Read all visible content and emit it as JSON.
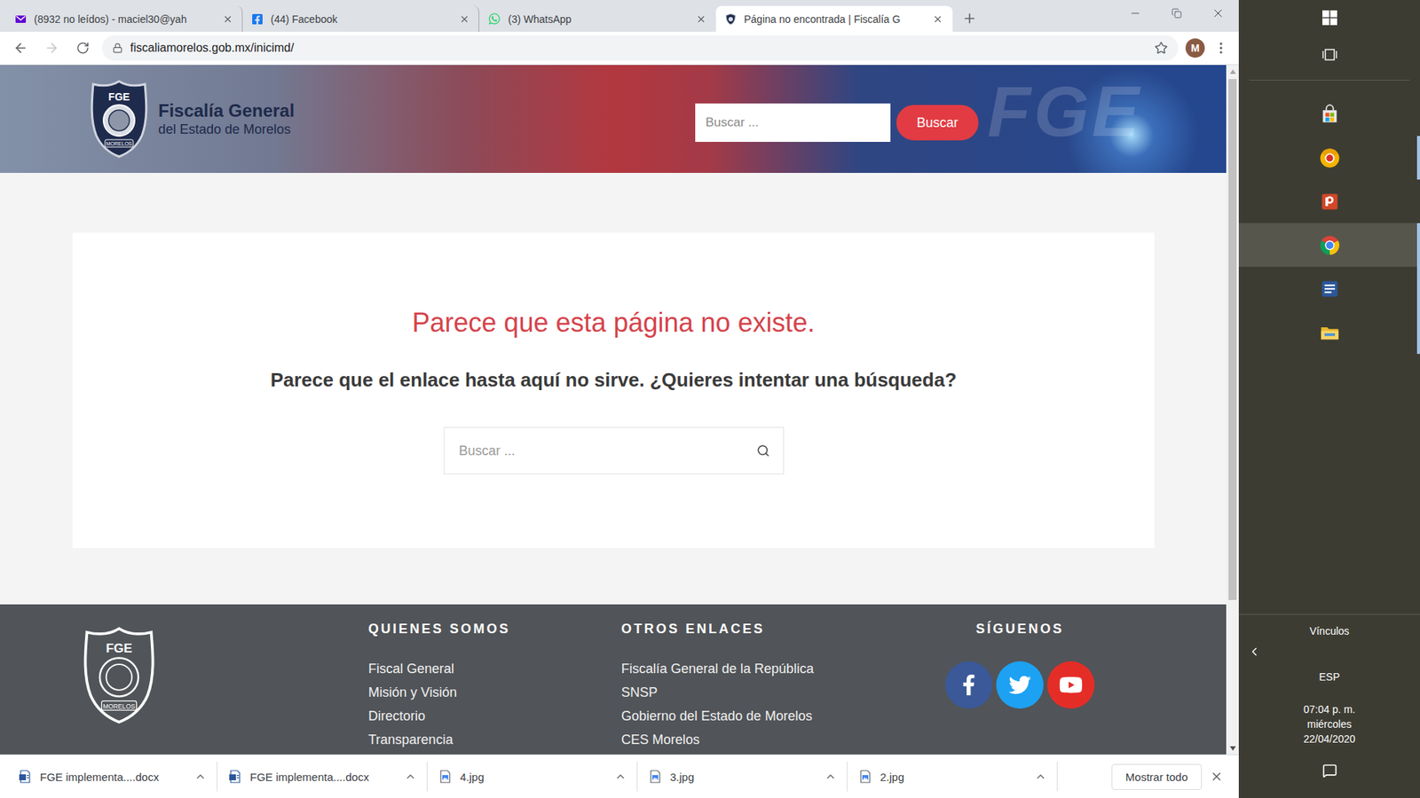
{
  "browser": {
    "tabs": [
      {
        "title": "(8932 no leídos) - maciel30@yah",
        "kind": "mail",
        "selected": false
      },
      {
        "title": "(44) Facebook",
        "kind": "facebook",
        "selected": false
      },
      {
        "title": "(3) WhatsApp",
        "kind": "whatsapp",
        "selected": false
      },
      {
        "title": "Página no encontrada | Fiscalía G",
        "kind": "site",
        "selected": true
      }
    ],
    "navigation": {
      "back_enabled": true,
      "forward_enabled": false
    },
    "address": "fiscaliamorelos.gob.mx/inicimd/",
    "bookmarked": false,
    "profile": "M"
  },
  "page": {
    "header": {
      "title": "Fiscalía General",
      "subtitle": "del Estado de Morelos",
      "badge": "FGE",
      "badge_caption": "MORELOS",
      "watermark": "FGE",
      "search_placeholder": "Buscar ...",
      "search_button": "Buscar"
    },
    "error": {
      "heading": "Parece que esta página no existe.",
      "message": "Parece que el enlace hasta aquí no sirve. ¿Quieres intentar una búsqueda?",
      "search_placeholder": "Buscar ..."
    },
    "footer": {
      "badge": "FGE",
      "badge_caption": "MORELOS",
      "columns": [
        {
          "title": "QUIENES SOMOS",
          "links": [
            "Fiscal General",
            "Misión y Visión",
            "Directorio",
            "Transparencia"
          ]
        },
        {
          "title": "OTROS ENLACES",
          "links": [
            "Fiscalía General de la República",
            "SNSP",
            "Gobierno del Estado de Morelos",
            "CES Morelos"
          ]
        }
      ],
      "social": {
        "title": "SÍGUENOS",
        "networks": [
          {
            "kind": "facebook",
            "color": "#3b5998"
          },
          {
            "kind": "twitter",
            "color": "#1da1f2"
          },
          {
            "kind": "youtube",
            "color": "#e52d27"
          }
        ]
      }
    }
  },
  "downloads": {
    "items": [
      {
        "name": "FGE implementa....docx",
        "kind": "docx"
      },
      {
        "name": "FGE implementa....docx",
        "kind": "docx"
      },
      {
        "name": "4.jpg",
        "kind": "image"
      },
      {
        "name": "3.jpg",
        "kind": "image"
      },
      {
        "name": "2.jpg",
        "kind": "image"
      }
    ],
    "show_all": "Mostrar todo"
  },
  "taskbar": {
    "apps": [
      {
        "kind": "store",
        "selected": false,
        "running": false
      },
      {
        "kind": "browser",
        "selected": false,
        "running": true
      },
      {
        "kind": "powerpoint",
        "selected": false,
        "running": false
      },
      {
        "kind": "chrome",
        "selected": true,
        "running": true
      },
      {
        "kind": "word",
        "selected": false,
        "running": true
      },
      {
        "kind": "explorer",
        "selected": false,
        "running": true
      }
    ],
    "links": "Vínculos",
    "language": "ESP",
    "time": "07:04 p. m.",
    "day": "miércoles",
    "date": "22/04/2020"
  }
}
